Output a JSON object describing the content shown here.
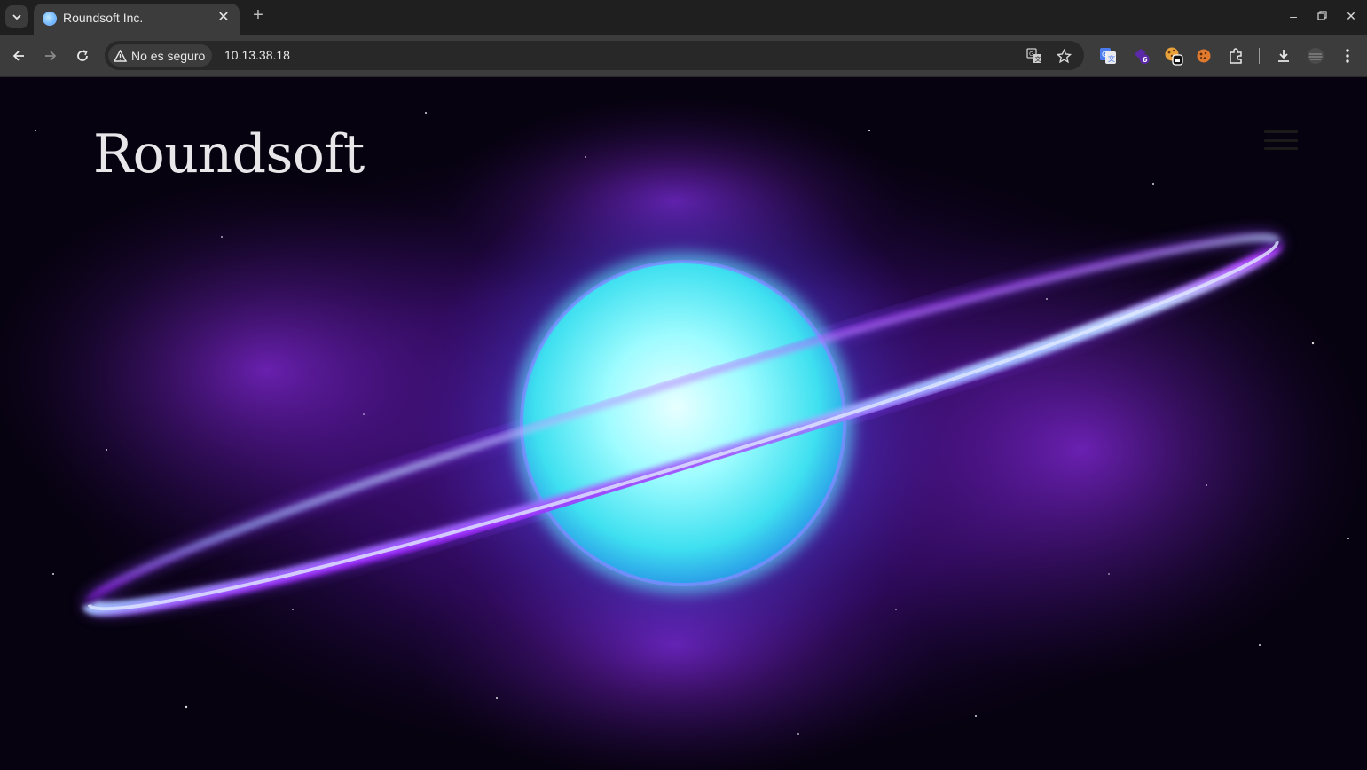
{
  "browser": {
    "tab": {
      "title": "Roundsoft Inc."
    },
    "address_bar": {
      "security_label": "No es seguro",
      "url": "10.13.38.18"
    },
    "extensions": [
      {
        "name": "google-translate-icon"
      },
      {
        "name": "extension-badge-icon",
        "badge": "6"
      },
      {
        "name": "cookie-editor-icon"
      },
      {
        "name": "cookie-icon"
      },
      {
        "name": "puzzle-extensions-icon"
      }
    ],
    "colors": {
      "frame": "#1f1f1f",
      "toolbar": "#3c3c3c",
      "omnibox": "#282828"
    }
  },
  "site": {
    "brand": "Roundsoft",
    "hero_colors": {
      "core": "#7ff7ff",
      "glow": "#5a6cff",
      "nebula": "#7a1fd0",
      "ring": "#c050ff"
    }
  }
}
